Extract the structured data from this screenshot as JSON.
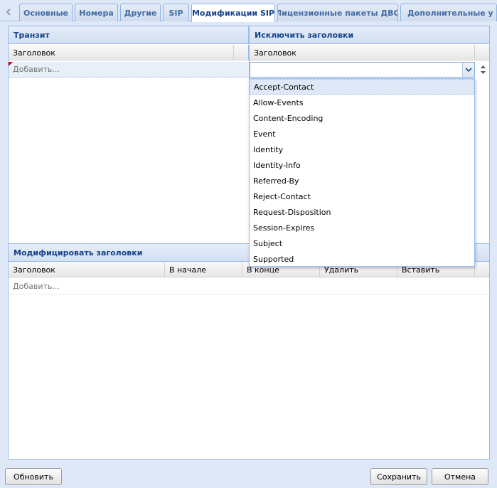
{
  "tabs": [
    {
      "label": "Основные",
      "active": false
    },
    {
      "label": "Номера",
      "active": false
    },
    {
      "label": "Другие",
      "active": false
    },
    {
      "label": "SIP",
      "active": false
    },
    {
      "label": "Модификации SIP",
      "active": true
    },
    {
      "label": "Лицензионные пакеты ДВО",
      "active": false
    },
    {
      "label": "Дополнительные у",
      "active": false
    }
  ],
  "transit": {
    "title": "Транзит",
    "column": "Заголовок",
    "add_placeholder": "Добавить..."
  },
  "exclude_headers": {
    "title": "Исключить заголовки",
    "column": "Заголовок",
    "combo_value": ""
  },
  "dropdown": {
    "options": [
      "Accept-Contact",
      "Allow-Events",
      "Content-Encoding",
      "Event",
      "Identity",
      "Identity-Info",
      "Referred-By",
      "Reject-Contact",
      "Request-Disposition",
      "Session-Expires",
      "Subject",
      "Supported"
    ],
    "highlighted": "Accept-Contact"
  },
  "modify_headers": {
    "title": "Модифицировать заголовки",
    "columns": [
      "Заголовок",
      "В начале",
      "В конце",
      "Удалить",
      "Вставить"
    ],
    "add_placeholder": "Добавить..."
  },
  "buttons": {
    "refresh": "Обновить",
    "save": "Сохранить",
    "cancel": "Отмена"
  },
  "icons": {
    "tab_scroll_left": "arrow-left-icon",
    "combo_trigger": "chevron-down-icon",
    "spinner": "spin-up-down-icon"
  }
}
